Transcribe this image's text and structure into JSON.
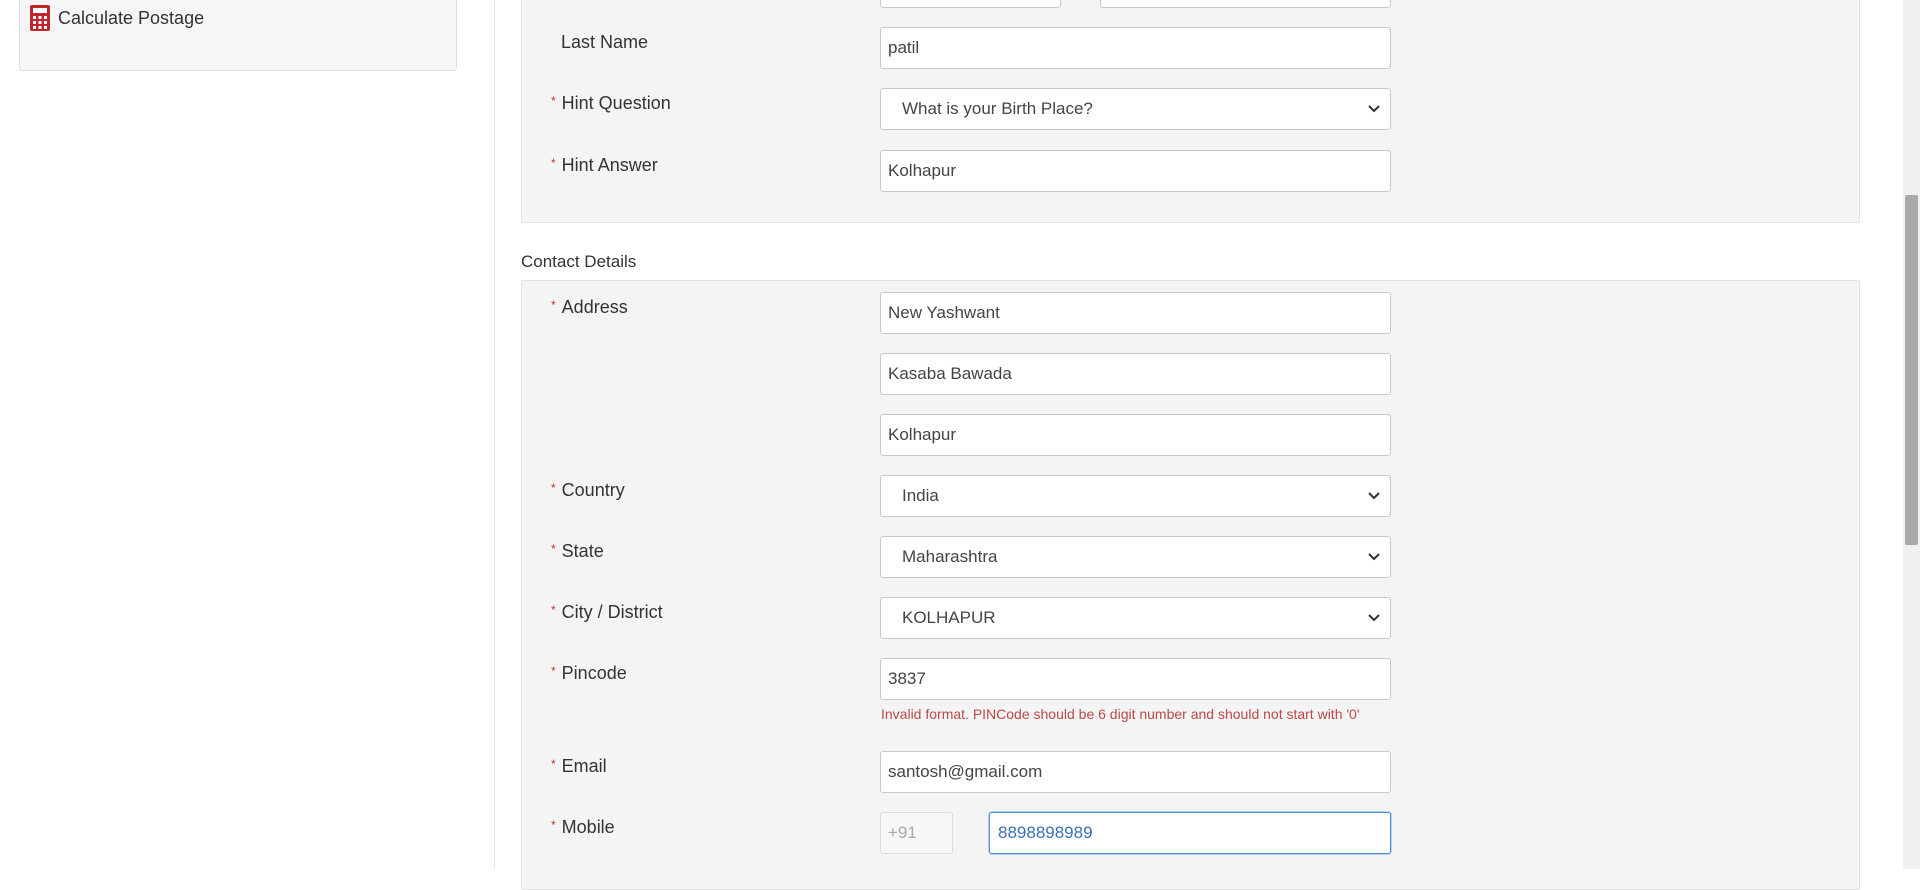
{
  "sidebar": {
    "calculate_postage_label": "Calculate Postage",
    "icon": "calculator-icon"
  },
  "personal": {
    "last_name_label": "Last Name",
    "last_name_value": "patil",
    "hint_question_label": "Hint Question",
    "hint_question_value": "What is your Birth Place?",
    "hint_answer_label": "Hint Answer",
    "hint_answer_value": "Kolhapur"
  },
  "contact": {
    "section_title": "Contact Details",
    "address_label": "Address",
    "address_line1": "New Yashwant",
    "address_line2": "Kasaba Bawada",
    "address_line3": "Kolhapur",
    "country_label": "Country",
    "country_value": "India",
    "state_label": "State",
    "state_value": "Maharashtra",
    "city_label": "City / District",
    "city_value": "KOLHAPUR",
    "pincode_label": "Pincode",
    "pincode_value": "3837",
    "pincode_error": "Invalid format. PINCode should be 6 digit number and should not start with '0'",
    "email_label": "Email",
    "email_value": "santosh@gmail.com",
    "mobile_label": "Mobile",
    "mobile_prefix": "+91",
    "mobile_value": "8898898989"
  },
  "required_marker": "*",
  "colors": {
    "required": "#c9302c",
    "error": "#b94a48",
    "focus": "#4a90d9",
    "icon": "#c0272d"
  }
}
